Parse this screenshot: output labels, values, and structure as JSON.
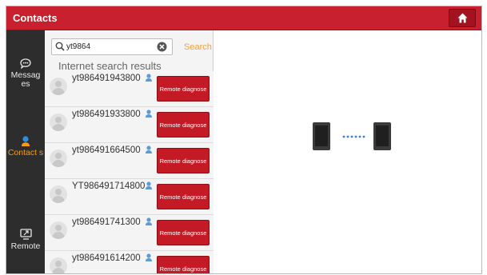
{
  "header": {
    "title": "Contacts"
  },
  "sidebar": {
    "items": [
      {
        "label": "Messag es",
        "icon": "chat-bubble-icon",
        "active": false
      },
      {
        "label": "Contact s",
        "icon": "person-icon",
        "active": true
      },
      {
        "label": "Remote",
        "icon": "remote-screen-icon",
        "active": false
      }
    ]
  },
  "search": {
    "value": "yt9864",
    "button_label": "Search"
  },
  "results": {
    "section_label": "Internet search results",
    "rows": [
      {
        "name": "yt986491943800",
        "button": "Remote diagnose"
      },
      {
        "name": "yt986491933800",
        "button": "Remote diagnose"
      },
      {
        "name": "yt986491664500",
        "button": "Remote diagnose"
      },
      {
        "name": "YT986491714800",
        "button": "Remote diagnose"
      },
      {
        "name": "yt986491741300",
        "button": "Remote diagnose"
      },
      {
        "name": "yt986491614200",
        "button": "Remote diagnose"
      }
    ]
  },
  "colors": {
    "brand_red": "#c8202e",
    "accent_orange": "#f39c12",
    "link_blue": "#3b82c4"
  }
}
